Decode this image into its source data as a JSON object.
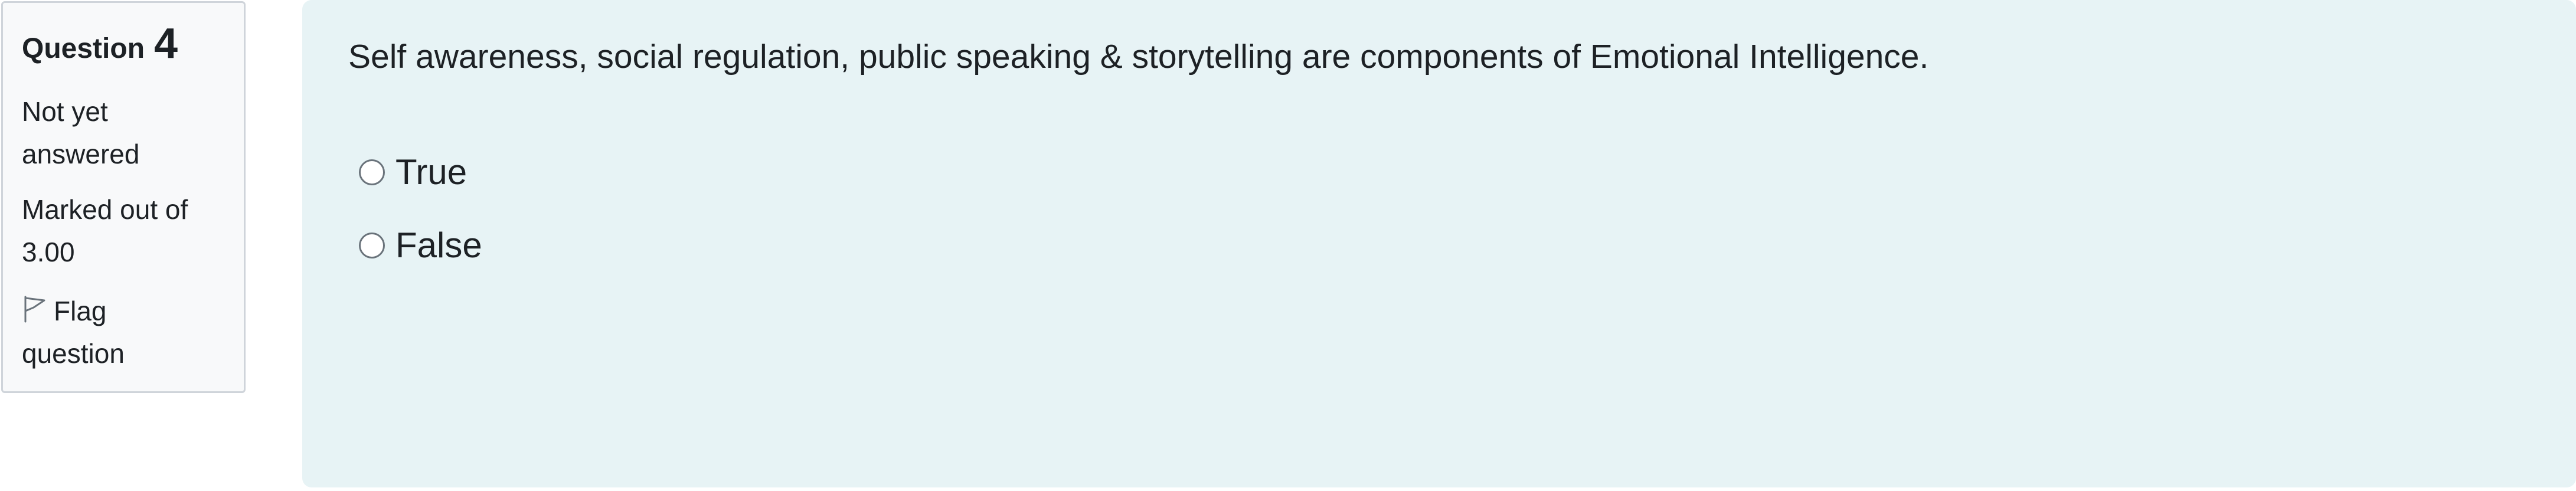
{
  "question_info": {
    "label": "Question",
    "number": "4",
    "status_lines": [
      "Not yet",
      "answered"
    ],
    "marks_lines": [
      "Marked out of",
      "3.00"
    ],
    "flag_lines": [
      "Flag",
      "question"
    ],
    "flag_icon": "flag-icon"
  },
  "question": {
    "text": "Self awareness, social regulation, public speaking & storytelling are components of Emotional Intelligence.",
    "options": [
      {
        "label": "True",
        "checked": false
      },
      {
        "label": "False",
        "checked": false
      }
    ]
  },
  "colors": {
    "info_background": "#f8f9fa",
    "info_border": "#cfd4da",
    "content_background": "#e7f3f5",
    "text": "#1d2125"
  }
}
